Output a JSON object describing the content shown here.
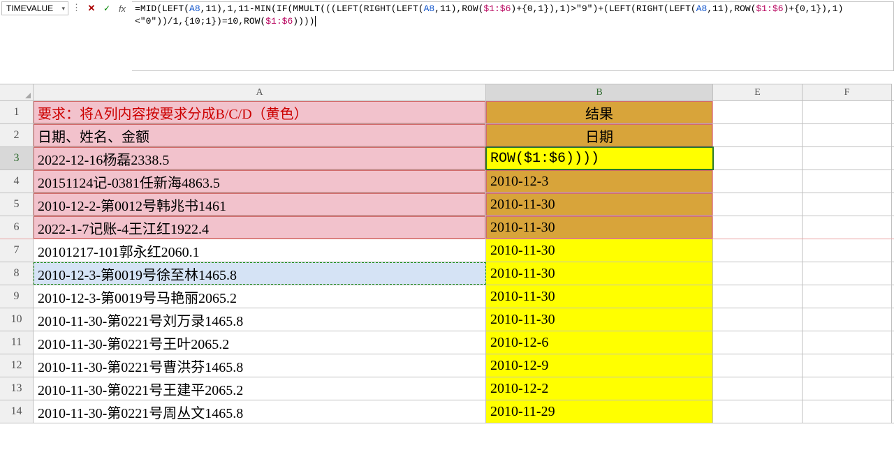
{
  "name_box": {
    "value": "TIMEVALUE"
  },
  "formula_bar": {
    "prefix": "=",
    "tokens": [
      {
        "t": "fn",
        "v": "MID("
      },
      {
        "t": "fn",
        "v": "LEFT("
      },
      {
        "t": "ref",
        "v": "A8"
      },
      {
        "t": "fn",
        "v": ",11),1,11-"
      },
      {
        "t": "fn",
        "v": "MIN("
      },
      {
        "t": "fn",
        "v": "IF("
      },
      {
        "t": "fn",
        "v": "MMULT((("
      },
      {
        "t": "fn",
        "v": "LEFT("
      },
      {
        "t": "fn",
        "v": "RIGHT("
      },
      {
        "t": "fn",
        "v": "LEFT("
      },
      {
        "t": "ref",
        "v": "A8"
      },
      {
        "t": "fn",
        "v": ",11),"
      },
      {
        "t": "fn",
        "v": "ROW("
      },
      {
        "t": "ref2",
        "v": "$1:$6"
      },
      {
        "t": "fn",
        "v": ")+{0,1}),1)>\"9\")+("
      },
      {
        "t": "fn",
        "v": "LEFT("
      },
      {
        "t": "fn",
        "v": "RIGHT("
      },
      {
        "t": "fn",
        "v": "LEFT("
      },
      {
        "t": "ref",
        "v": "A8"
      },
      {
        "t": "fn",
        "v": ",11),"
      },
      {
        "t": "fn",
        "v": "ROW("
      },
      {
        "t": "ref2",
        "v": "$1:$6"
      },
      {
        "t": "fn",
        "v": ")+{0,1}),1)<\"0\"))/1,{10;1})=10,"
      },
      {
        "t": "fn",
        "v": "ROW("
      },
      {
        "t": "ref2",
        "v": "$1:$6"
      },
      {
        "t": "fn",
        "v": "))))"
      }
    ]
  },
  "columns": [
    "A",
    "B",
    "E",
    "F"
  ],
  "chart_data": {
    "type": "table",
    "title": "要求：将A列内容按要求分成B/C/D（黄色）",
    "headers_row2": {
      "A": "日期、姓名、金额",
      "B": "日期",
      "B_group": "结果"
    },
    "rows": [
      {
        "n": 3,
        "A": "2022-12-16杨磊2338.5",
        "B": "ROW($1:$6))))"
      },
      {
        "n": 4,
        "A": "20151124记-0381任新海4863.5",
        "B": "2010-12-3"
      },
      {
        "n": 5,
        "A": "2010-12-2-第0012号韩兆书1461",
        "B": "2010-11-30"
      },
      {
        "n": 6,
        "A": "2022-1-7记账-4王江红1922.4",
        "B": "2010-11-30"
      },
      {
        "n": 7,
        "A": "20101217-101郭永红2060.1",
        "B": "2010-11-30"
      },
      {
        "n": 8,
        "A": "2010-12-3-第0019号徐至林1465.8",
        "B": "2010-11-30"
      },
      {
        "n": 9,
        "A": "2010-12-3-第0019号马艳丽2065.2",
        "B": "2010-11-30"
      },
      {
        "n": 10,
        "A": "2010-11-30-第0221号刘万录1465.8",
        "B": "2010-11-30"
      },
      {
        "n": 11,
        "A": "2010-11-30-第0221号王叶2065.2",
        "B": "2010-12-6"
      },
      {
        "n": 12,
        "A": "2010-11-30-第0221号曹洪芬1465.8",
        "B": "2010-12-9"
      },
      {
        "n": 13,
        "A": "2010-11-30-第0221号王建平2065.2",
        "B": "2010-12-2"
      },
      {
        "n": 14,
        "A": "2010-11-30-第0221号周丛文1465.8",
        "B": "2010-11-29"
      }
    ]
  }
}
